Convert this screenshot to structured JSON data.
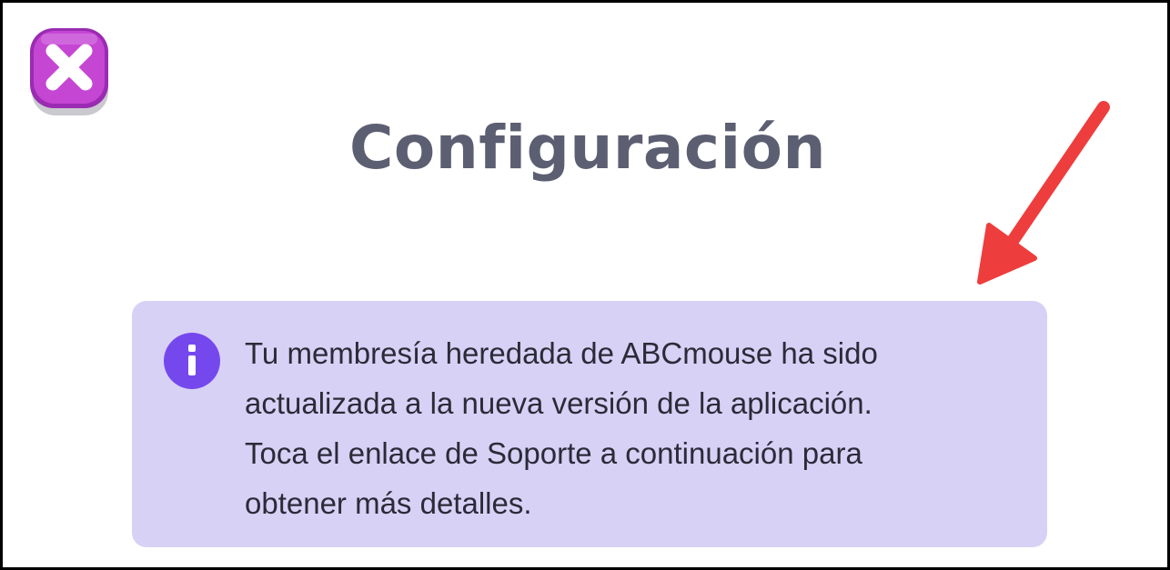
{
  "dialog": {
    "title": "Configuración",
    "close_icon": "close-x-icon"
  },
  "notice": {
    "icon": "info-icon",
    "lines": [
      "Tu membresía heredada de ABCmouse ha sido",
      "actualizada a la nueva versión de la aplicación.",
      "Toca el enlace de Soporte a continuación para",
      "obtener más detalles."
    ]
  },
  "annotation": {
    "type": "arrow",
    "color": "#ee3d3d"
  },
  "colors": {
    "title": "#5c5e72",
    "banner_background": "#d8d1f6",
    "info_icon": "#7548ee",
    "close_button": "#c646d4"
  }
}
